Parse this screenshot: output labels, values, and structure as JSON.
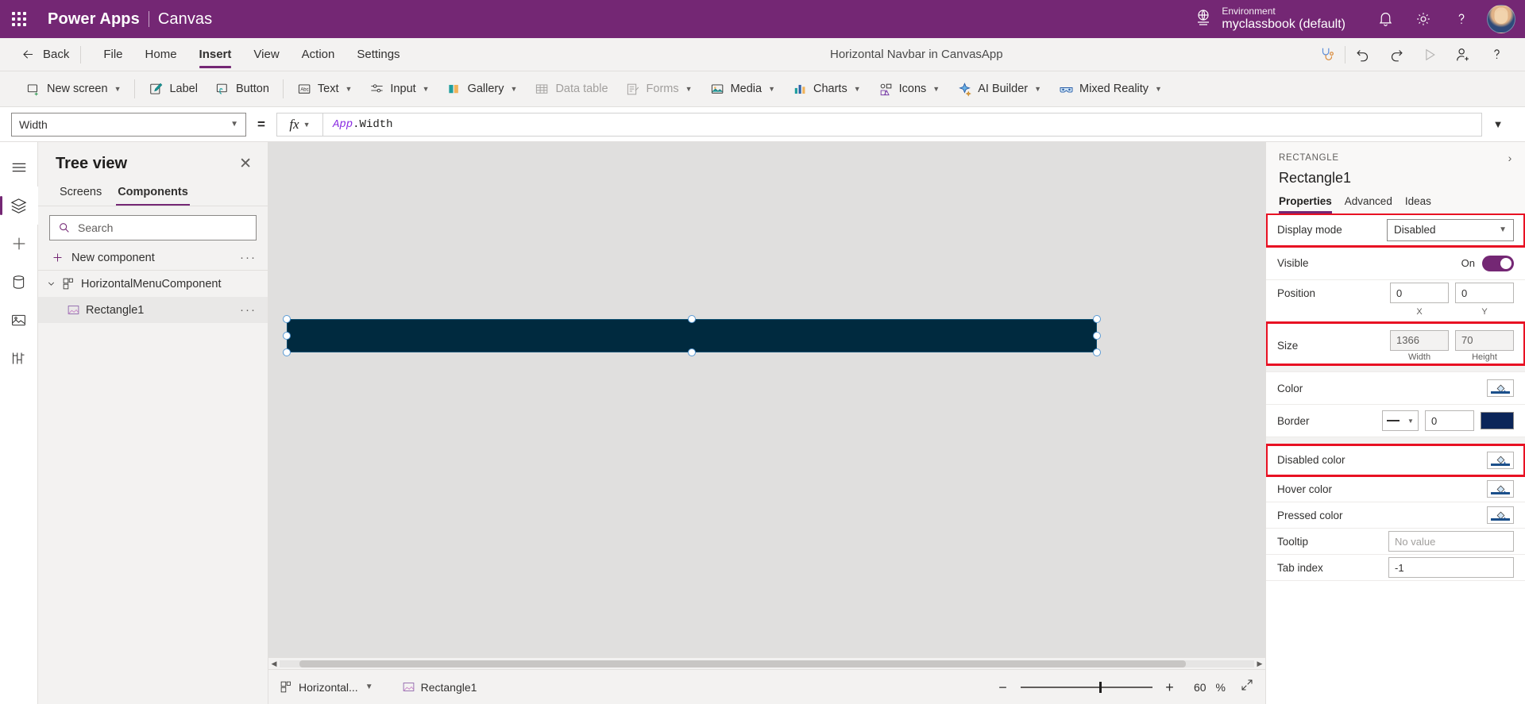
{
  "topbar": {
    "waffle_name": "app-launcher",
    "brand": "Power Apps",
    "separator": "|",
    "sub_brand": "Canvas",
    "env_label": "Environment",
    "env_name": "myclassbook (default)",
    "icons": [
      "globe-icon",
      "notification-bell-icon",
      "settings-gear-icon",
      "help-question-icon",
      "user-avatar"
    ],
    "purple": "#742774"
  },
  "menubar": {
    "back_label": "Back",
    "items": [
      {
        "label": "File",
        "active": false
      },
      {
        "label": "Home",
        "active": false
      },
      {
        "label": "Insert",
        "active": true
      },
      {
        "label": "View",
        "active": false
      },
      {
        "label": "Action",
        "active": false
      },
      {
        "label": "Settings",
        "active": false
      }
    ],
    "app_name": "Horizontal Navbar in CanvasApp",
    "right_icons": [
      "app-checker-stethoscope-icon",
      "undo-icon",
      "redo-icon",
      "preview-play-icon",
      "share-add-user-icon",
      "help-question-icon"
    ]
  },
  "ribbon": {
    "items": [
      {
        "label": "New screen",
        "icon": "new-screen-icon",
        "chevron": true,
        "disabled": false
      },
      {
        "label": "Label",
        "icon": "label-icon",
        "chevron": false,
        "disabled": false
      },
      {
        "label": "Button",
        "icon": "button-icon",
        "chevron": false,
        "disabled": false
      },
      {
        "label": "Text",
        "icon": "text-icon",
        "chevron": true,
        "disabled": false
      },
      {
        "label": "Input",
        "icon": "input-icon",
        "chevron": true,
        "disabled": false
      },
      {
        "label": "Gallery",
        "icon": "gallery-icon",
        "chevron": true,
        "disabled": false
      },
      {
        "label": "Data table",
        "icon": "data-table-icon",
        "chevron": false,
        "disabled": true
      },
      {
        "label": "Forms",
        "icon": "forms-icon",
        "chevron": true,
        "disabled": true
      },
      {
        "label": "Media",
        "icon": "media-icon",
        "chevron": true,
        "disabled": false
      },
      {
        "label": "Charts",
        "icon": "charts-icon",
        "chevron": true,
        "disabled": false
      },
      {
        "label": "Icons",
        "icon": "icons-icon",
        "chevron": true,
        "disabled": false
      },
      {
        "label": "AI Builder",
        "icon": "ai-builder-icon",
        "chevron": true,
        "disabled": false
      },
      {
        "label": "Mixed Reality",
        "icon": "mixed-reality-icon",
        "chevron": true,
        "disabled": false
      }
    ]
  },
  "formula_bar": {
    "property": "Width",
    "equals": "=",
    "fx_label": "fx",
    "formula_prefix": "App",
    "formula_suffix": ".Width"
  },
  "rail": {
    "items": [
      "hamburger-menu-icon",
      "tree-view-layers-icon",
      "insert-plus-icon",
      "data-cylinder-icon",
      "media-image-icon",
      "advanced-tools-icon"
    ]
  },
  "tree_view": {
    "title": "Tree view",
    "close_label": "✕",
    "tabs": [
      {
        "label": "Screens",
        "active": false
      },
      {
        "label": "Components",
        "active": true
      }
    ],
    "search_placeholder": "Search",
    "new_component_label": "New component",
    "overflow_dots": "···",
    "nodes": [
      {
        "label": "HorizontalMenuComponent",
        "icon": "component-icon",
        "level": 0,
        "expanded": true
      },
      {
        "label": "Rectangle1",
        "icon": "rectangle-shape-icon",
        "level": 1,
        "selected": true
      }
    ]
  },
  "canvas": {
    "rectangle_fill": "#002a3f",
    "selected_element": "Rectangle1"
  },
  "statusbar": {
    "screen_label": "Horizontal...",
    "control_label": "Rectangle1",
    "zoom_minus": "−",
    "zoom_plus": "+",
    "zoom_value": "60",
    "zoom_unit": "%",
    "fit_icon": "fit-to-screen-icon"
  },
  "properties": {
    "kicker": "RECTANGLE",
    "name": "Rectangle1",
    "tabs": [
      {
        "label": "Properties",
        "active": true
      },
      {
        "label": "Advanced",
        "active": false
      },
      {
        "label": "Ideas",
        "active": false
      }
    ],
    "rows": [
      {
        "key": "display_mode",
        "label": "Display mode",
        "value": "Disabled",
        "highlighted": true
      },
      {
        "key": "visible",
        "label": "Visible",
        "value": "On",
        "highlighted": false
      },
      {
        "key": "position",
        "label": "Position",
        "x": "0",
        "y": "0",
        "x_label": "X",
        "y_label": "Y",
        "highlighted": false
      },
      {
        "key": "size",
        "label": "Size",
        "width": "1366",
        "height": "70",
        "width_label": "Width",
        "height_label": "Height",
        "highlighted": true
      },
      {
        "key": "color",
        "label": "Color",
        "highlighted": false
      },
      {
        "key": "border",
        "label": "Border",
        "thickness": "0",
        "color": "#0b2559",
        "highlighted": false
      },
      {
        "key": "disabled_color",
        "label": "Disabled color",
        "highlighted": true
      },
      {
        "key": "hover_color",
        "label": "Hover color",
        "highlighted": false
      },
      {
        "key": "pressed_color",
        "label": "Pressed color",
        "highlighted": false
      },
      {
        "key": "tooltip",
        "label": "Tooltip",
        "value": "No value",
        "highlighted": false
      },
      {
        "key": "tab_index",
        "label": "Tab index",
        "value": "-1",
        "highlighted": false
      }
    ],
    "highlight_color": "#e81123"
  }
}
